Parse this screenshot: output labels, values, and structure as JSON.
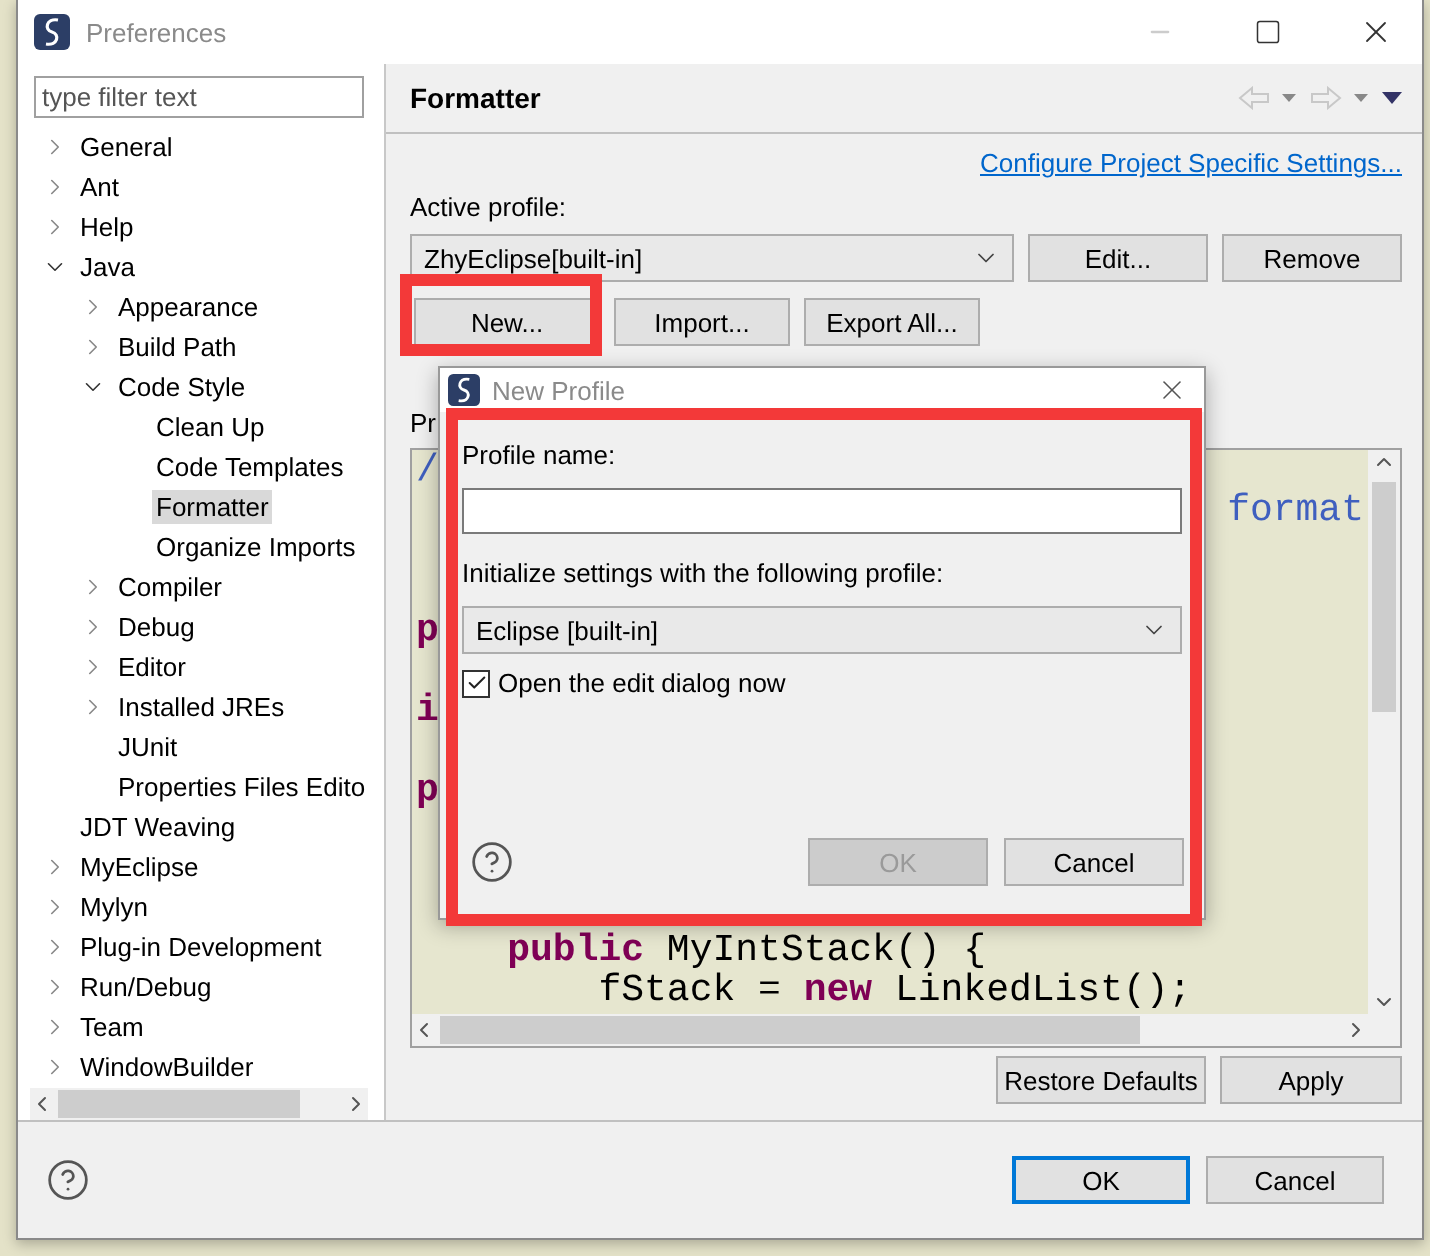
{
  "window": {
    "title": "Preferences"
  },
  "filter": {
    "placeholder": "type filter text"
  },
  "tree": [
    {
      "label": "General",
      "expanded": false,
      "selected": false
    },
    {
      "label": "Ant",
      "expanded": false,
      "selected": false
    },
    {
      "label": "Help",
      "expanded": false,
      "selected": false
    },
    {
      "label": "Java",
      "expanded": true,
      "selected": false,
      "children": [
        {
          "label": "Appearance",
          "expanded": false,
          "selected": false
        },
        {
          "label": "Build Path",
          "expanded": false,
          "selected": false
        },
        {
          "label": "Code Style",
          "expanded": true,
          "selected": false,
          "children": [
            {
              "label": "Clean Up",
              "selected": false
            },
            {
              "label": "Code Templates",
              "selected": false
            },
            {
              "label": "Formatter",
              "selected": true
            },
            {
              "label": "Organize Imports",
              "selected": false
            }
          ]
        },
        {
          "label": "Compiler",
          "expanded": false,
          "selected": false
        },
        {
          "label": "Debug",
          "expanded": false,
          "selected": false
        },
        {
          "label": "Editor",
          "expanded": false,
          "selected": false
        },
        {
          "label": "Installed JREs",
          "expanded": false,
          "selected": false
        },
        {
          "label": "JUnit",
          "selected": false
        },
        {
          "label": "Properties Files Edito",
          "selected": false
        }
      ]
    },
    {
      "label": "JDT Weaving",
      "selected": false
    },
    {
      "label": "MyEclipse",
      "expanded": false,
      "selected": false
    },
    {
      "label": "Mylyn",
      "expanded": false,
      "selected": false
    },
    {
      "label": "Plug-in Development",
      "expanded": false,
      "selected": false
    },
    {
      "label": "Run/Debug",
      "expanded": false,
      "selected": false
    },
    {
      "label": "Team",
      "expanded": false,
      "selected": false
    },
    {
      "label": "WindowBuilder",
      "expanded": false,
      "selected": false
    }
  ],
  "page": {
    "title": "Formatter",
    "link": "Configure Project Specific Settings...",
    "active_profile_label": "Active profile:",
    "active_profile": "ZhyEclipse[built-in]",
    "profile_buttons": [
      "Edit...",
      "Remove"
    ],
    "action_buttons": [
      "New...",
      "Import...",
      "Export All..."
    ],
    "preview_label": "Pr",
    "preview_lines": [
      {
        "text": "/",
        "kind": "comment"
      },
      {
        "text": "format",
        "kind": "comment-tail"
      },
      {
        "text": "p",
        "kind": "keyword"
      },
      {
        "text": "i",
        "kind": "keyword"
      },
      {
        "text": "p",
        "kind": "keyword"
      },
      {
        "text": "    **public** MyIntStack() {",
        "kind": "code"
      },
      {
        "text": "        fStack = **new** LinkedList();",
        "kind": "code"
      }
    ],
    "buttons": [
      "Restore Defaults",
      "Apply"
    ]
  },
  "footer_buttons": [
    {
      "label": "OK",
      "default": true
    },
    {
      "label": "Cancel",
      "default": false
    }
  ],
  "dialog": {
    "title": "New Profile",
    "name_label": "Profile name:",
    "init_label": "Initialize settings with the following profile:",
    "init_profile": "Eclipse [built-in]",
    "open_editor": {
      "label": "Open the edit dialog now",
      "checked": true
    },
    "buttons": [
      {
        "label": "OK",
        "disabled": true
      },
      {
        "label": "Cancel",
        "disabled": false
      }
    ]
  }
}
